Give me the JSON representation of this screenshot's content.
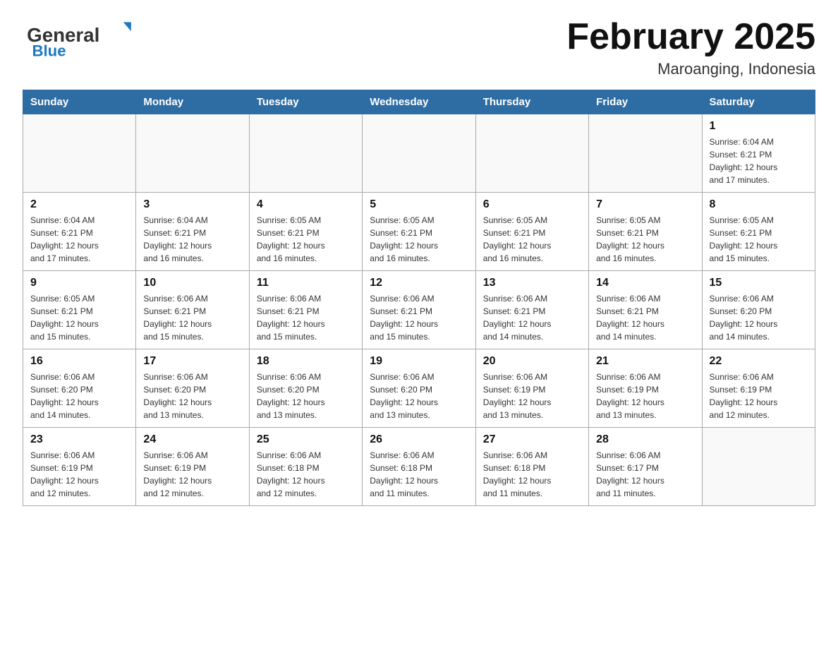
{
  "header": {
    "logo_general": "General",
    "logo_blue": "Blue",
    "title": "February 2025",
    "subtitle": "Maroanging, Indonesia"
  },
  "weekdays": [
    "Sunday",
    "Monday",
    "Tuesday",
    "Wednesday",
    "Thursday",
    "Friday",
    "Saturday"
  ],
  "weeks": [
    [
      {
        "day": "",
        "info": ""
      },
      {
        "day": "",
        "info": ""
      },
      {
        "day": "",
        "info": ""
      },
      {
        "day": "",
        "info": ""
      },
      {
        "day": "",
        "info": ""
      },
      {
        "day": "",
        "info": ""
      },
      {
        "day": "1",
        "info": "Sunrise: 6:04 AM\nSunset: 6:21 PM\nDaylight: 12 hours\nand 17 minutes."
      }
    ],
    [
      {
        "day": "2",
        "info": "Sunrise: 6:04 AM\nSunset: 6:21 PM\nDaylight: 12 hours\nand 17 minutes."
      },
      {
        "day": "3",
        "info": "Sunrise: 6:04 AM\nSunset: 6:21 PM\nDaylight: 12 hours\nand 16 minutes."
      },
      {
        "day": "4",
        "info": "Sunrise: 6:05 AM\nSunset: 6:21 PM\nDaylight: 12 hours\nand 16 minutes."
      },
      {
        "day": "5",
        "info": "Sunrise: 6:05 AM\nSunset: 6:21 PM\nDaylight: 12 hours\nand 16 minutes."
      },
      {
        "day": "6",
        "info": "Sunrise: 6:05 AM\nSunset: 6:21 PM\nDaylight: 12 hours\nand 16 minutes."
      },
      {
        "day": "7",
        "info": "Sunrise: 6:05 AM\nSunset: 6:21 PM\nDaylight: 12 hours\nand 16 minutes."
      },
      {
        "day": "8",
        "info": "Sunrise: 6:05 AM\nSunset: 6:21 PM\nDaylight: 12 hours\nand 15 minutes."
      }
    ],
    [
      {
        "day": "9",
        "info": "Sunrise: 6:05 AM\nSunset: 6:21 PM\nDaylight: 12 hours\nand 15 minutes."
      },
      {
        "day": "10",
        "info": "Sunrise: 6:06 AM\nSunset: 6:21 PM\nDaylight: 12 hours\nand 15 minutes."
      },
      {
        "day": "11",
        "info": "Sunrise: 6:06 AM\nSunset: 6:21 PM\nDaylight: 12 hours\nand 15 minutes."
      },
      {
        "day": "12",
        "info": "Sunrise: 6:06 AM\nSunset: 6:21 PM\nDaylight: 12 hours\nand 15 minutes."
      },
      {
        "day": "13",
        "info": "Sunrise: 6:06 AM\nSunset: 6:21 PM\nDaylight: 12 hours\nand 14 minutes."
      },
      {
        "day": "14",
        "info": "Sunrise: 6:06 AM\nSunset: 6:21 PM\nDaylight: 12 hours\nand 14 minutes."
      },
      {
        "day": "15",
        "info": "Sunrise: 6:06 AM\nSunset: 6:20 PM\nDaylight: 12 hours\nand 14 minutes."
      }
    ],
    [
      {
        "day": "16",
        "info": "Sunrise: 6:06 AM\nSunset: 6:20 PM\nDaylight: 12 hours\nand 14 minutes."
      },
      {
        "day": "17",
        "info": "Sunrise: 6:06 AM\nSunset: 6:20 PM\nDaylight: 12 hours\nand 13 minutes."
      },
      {
        "day": "18",
        "info": "Sunrise: 6:06 AM\nSunset: 6:20 PM\nDaylight: 12 hours\nand 13 minutes."
      },
      {
        "day": "19",
        "info": "Sunrise: 6:06 AM\nSunset: 6:20 PM\nDaylight: 12 hours\nand 13 minutes."
      },
      {
        "day": "20",
        "info": "Sunrise: 6:06 AM\nSunset: 6:19 PM\nDaylight: 12 hours\nand 13 minutes."
      },
      {
        "day": "21",
        "info": "Sunrise: 6:06 AM\nSunset: 6:19 PM\nDaylight: 12 hours\nand 13 minutes."
      },
      {
        "day": "22",
        "info": "Sunrise: 6:06 AM\nSunset: 6:19 PM\nDaylight: 12 hours\nand 12 minutes."
      }
    ],
    [
      {
        "day": "23",
        "info": "Sunrise: 6:06 AM\nSunset: 6:19 PM\nDaylight: 12 hours\nand 12 minutes."
      },
      {
        "day": "24",
        "info": "Sunrise: 6:06 AM\nSunset: 6:19 PM\nDaylight: 12 hours\nand 12 minutes."
      },
      {
        "day": "25",
        "info": "Sunrise: 6:06 AM\nSunset: 6:18 PM\nDaylight: 12 hours\nand 12 minutes."
      },
      {
        "day": "26",
        "info": "Sunrise: 6:06 AM\nSunset: 6:18 PM\nDaylight: 12 hours\nand 11 minutes."
      },
      {
        "day": "27",
        "info": "Sunrise: 6:06 AM\nSunset: 6:18 PM\nDaylight: 12 hours\nand 11 minutes."
      },
      {
        "day": "28",
        "info": "Sunrise: 6:06 AM\nSunset: 6:17 PM\nDaylight: 12 hours\nand 11 minutes."
      },
      {
        "day": "",
        "info": ""
      }
    ]
  ]
}
